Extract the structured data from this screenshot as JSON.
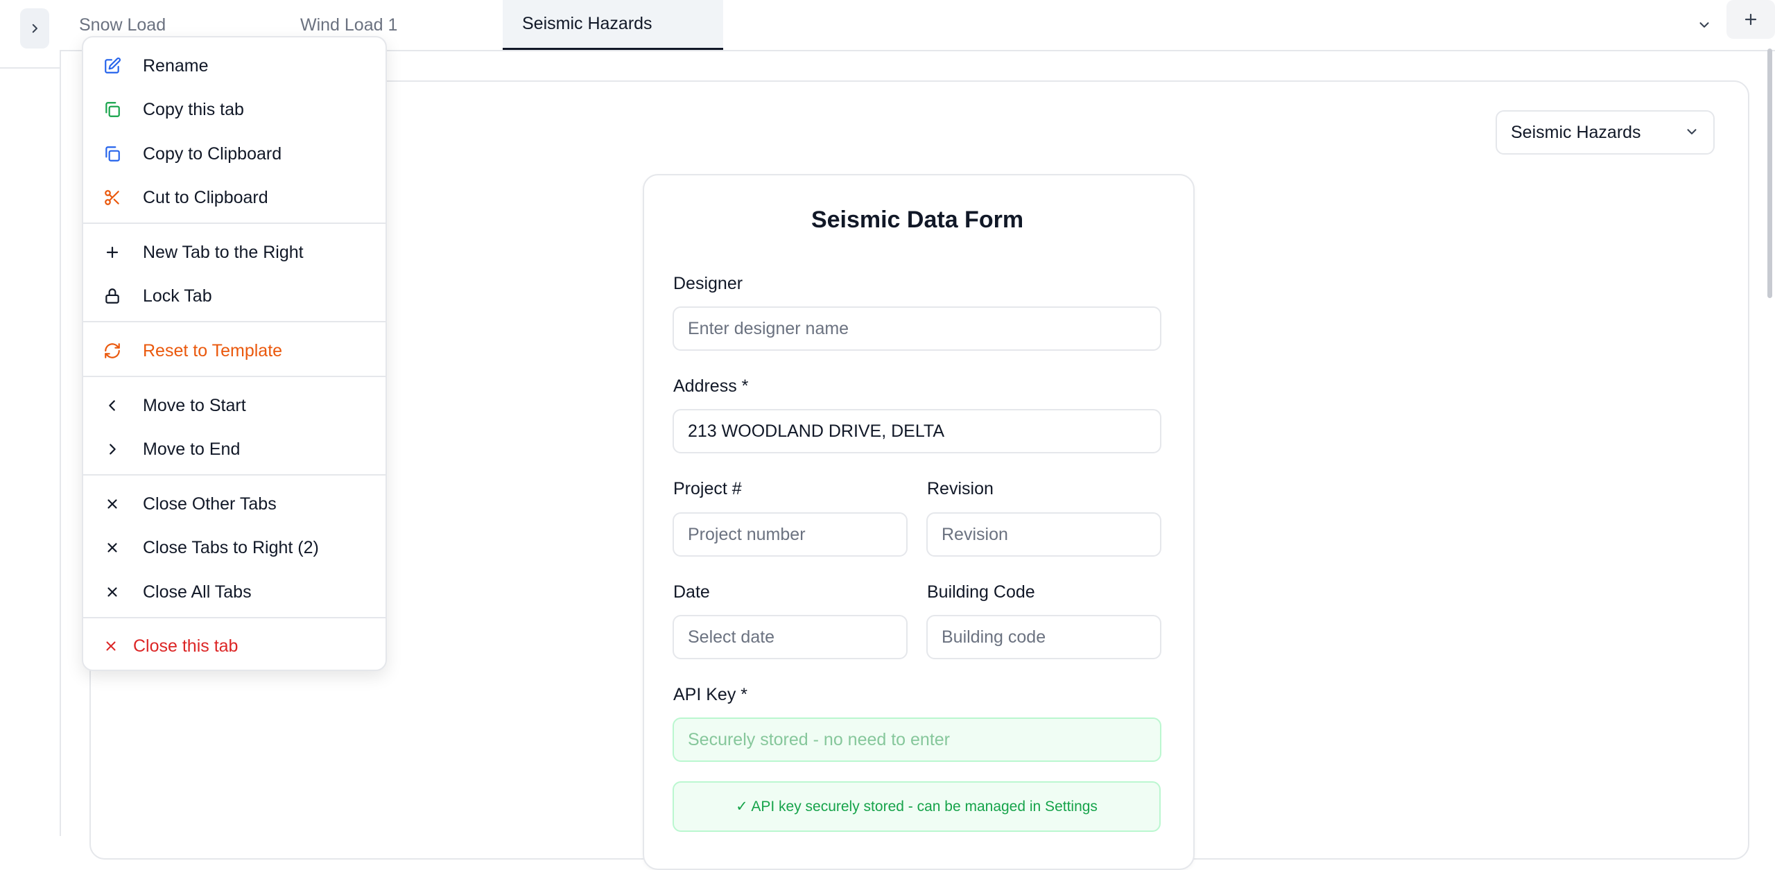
{
  "tabs": [
    {
      "label": "Snow Load"
    },
    {
      "label": "Wind Load 1"
    },
    {
      "label": "Seismic Hazards"
    }
  ],
  "selector": {
    "value": "Seismic Hazards"
  },
  "form": {
    "title": "Seismic Data Form",
    "designer_label": "Designer",
    "designer_placeholder": "Enter designer name",
    "address_label": "Address *",
    "address_value": "213 WOODLAND DRIVE, DELTA",
    "project_label": "Project #",
    "project_placeholder": "Project number",
    "revision_label": "Revision",
    "revision_placeholder": "Revision",
    "date_label": "Date",
    "date_placeholder": "Select date",
    "building_code_label": "Building Code",
    "building_code_placeholder": "Building code",
    "api_key_label": "API Key *",
    "api_key_placeholder": "Securely stored - no need to enter",
    "api_notice": "✓ API key securely stored - can be managed in Settings"
  },
  "menu": {
    "items": [
      {
        "label": "Rename",
        "icon": "pencil-square-icon"
      },
      {
        "label": "Copy this tab",
        "icon": "copy-icon"
      },
      {
        "label": "Copy to Clipboard",
        "icon": "copy-icon"
      },
      {
        "label": "Cut to Clipboard",
        "icon": "scissors-icon"
      },
      {
        "label": "New Tab to the Right",
        "icon": "plus-icon"
      },
      {
        "label": "Lock Tab",
        "icon": "lock-icon"
      },
      {
        "label": "Reset to Template",
        "icon": "refresh-icon"
      },
      {
        "label": "Move to Start",
        "icon": "chevron-left-icon"
      },
      {
        "label": "Move to End",
        "icon": "chevron-right-icon"
      },
      {
        "label": "Close Other Tabs",
        "icon": "x-icon"
      },
      {
        "label": "Close Tabs to Right (2)",
        "icon": "x-icon"
      },
      {
        "label": "Close All Tabs",
        "icon": "x-icon"
      },
      {
        "label": "Close this tab",
        "icon": "x-icon"
      }
    ]
  },
  "colors": {
    "blue": "#2563eb",
    "green": "#16a34a",
    "orange": "#ea580c",
    "red": "#dc2626",
    "text": "#111827",
    "muted": "#6b7280"
  }
}
